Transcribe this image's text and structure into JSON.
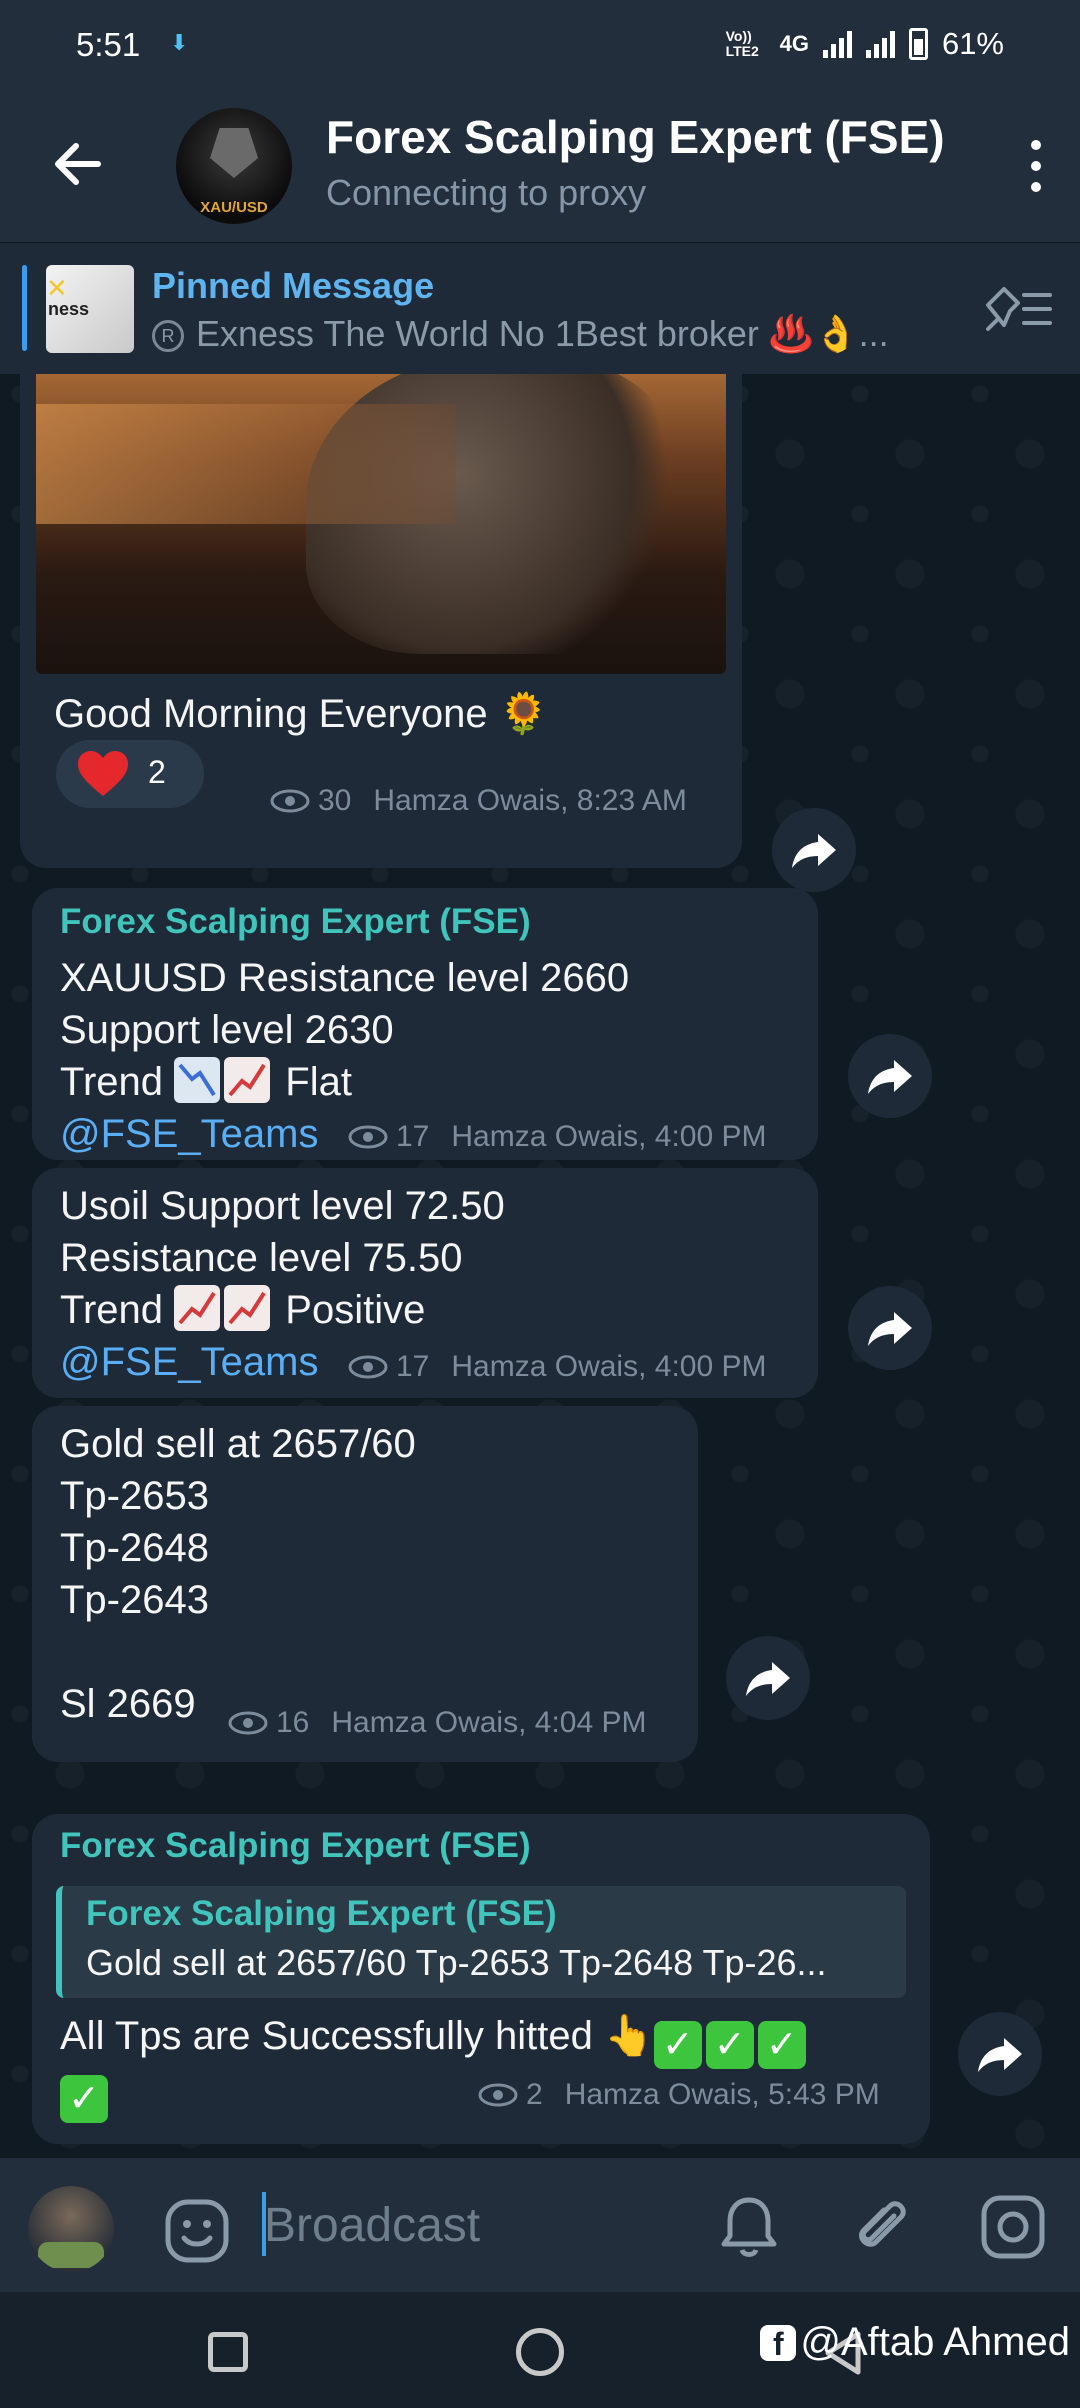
{
  "status_bar": {
    "time": "5:51",
    "volte": "Vo)) LTE2",
    "network": "4G",
    "battery": "61%"
  },
  "header": {
    "title": "Forex Scalping Expert (FSE)",
    "subtitle": "Connecting to proxy",
    "avatar_text": "XAU/USD"
  },
  "pinned": {
    "title": "Pinned Message",
    "thumb_text": "ness",
    "reg_symbol": "R",
    "text": "Exness The World  No 1Best broker ♨️👌..."
  },
  "messages": [
    {
      "text": "Good Morning Everyone 🌻",
      "reaction_count": "2",
      "views": "30",
      "meta": "Hamza Owais, 8:23 AM"
    },
    {
      "sender": "Forex Scalping Expert (FSE)",
      "line1": "XAUUSD Resistance level 2660",
      "line2": "Support level 2630",
      "line3_prefix": "Trend",
      "line3_suffix": "Flat",
      "link": "@FSE_Teams",
      "views": "17",
      "meta": "Hamza Owais, 4:00 PM"
    },
    {
      "line1": "Usoil Support level 72.50",
      "line2": "Resistance level 75.50",
      "line3_prefix": "Trend",
      "line3_suffix": "Positive",
      "link": "@FSE_Teams",
      "views": "17",
      "meta": "Hamza Owais, 4:00 PM"
    },
    {
      "line1": "Gold sell at 2657/60",
      "line2": "Tp-2653",
      "line3": "Tp-2648",
      "line4": "Tp-2643",
      "line5": "Sl 2669",
      "views": "16",
      "meta": "Hamza Owais, 4:04 PM"
    },
    {
      "sender": "Forex Scalping Expert (FSE)",
      "quote_sender": "Forex Scalping Expert (FSE)",
      "quote_text": "Gold sell at 2657/60 Tp-2653 Tp-2648 Tp-26...",
      "text": "All Tps are Successfully hitted 👆",
      "views": "2",
      "meta": "Hamza Owais, 5:43 PM"
    }
  ],
  "input": {
    "placeholder": "Broadcast"
  },
  "watermark": "@Aftab Ahmed",
  "colors": {
    "accent": "#3d9be9",
    "sender": "#40c4bc",
    "bubble": "#1e2a37",
    "background": "#0f1a23",
    "header": "#232e3c"
  }
}
